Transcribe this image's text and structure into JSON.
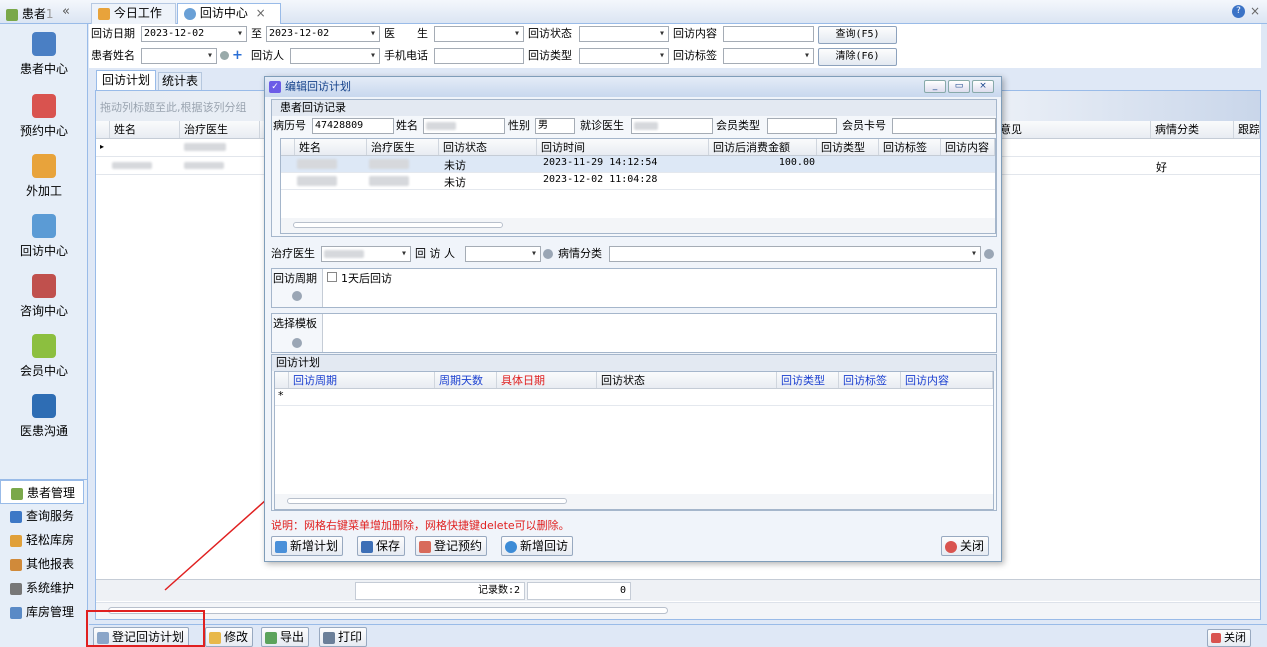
{
  "top_tabs": {
    "patient_panel_title": "患者",
    "collapse_glyph": "«",
    "tab1_label": "今日工作",
    "tab2_label": "回访中心",
    "close_glyph": "×",
    "help_glyph": "?"
  },
  "left_nav": {
    "big_items": [
      {
        "label": "患者中心",
        "icon": "patients-icon",
        "color": "#4a7fc4"
      },
      {
        "label": "预约中心",
        "icon": "calendar-icon",
        "color": "#d9534f"
      },
      {
        "label": "外加工",
        "icon": "cubes-icon",
        "color": "#e8a33b"
      },
      {
        "label": "回访中心",
        "icon": "refresh-icon",
        "color": "#5b9bd5"
      },
      {
        "label": "咨询中心",
        "icon": "consult-icon",
        "color": "#c0504d"
      },
      {
        "label": "会员中心",
        "icon": "members-icon",
        "color": "#8cbf3f"
      },
      {
        "label": "医患沟通",
        "icon": "media-icon",
        "color": "#2e6db4"
      }
    ],
    "small_items": [
      {
        "label": "患者管理",
        "icon": "patients-small-icon",
        "color": "#7aa84a"
      },
      {
        "label": "查询服务",
        "icon": "search-small-icon",
        "color": "#3d78c6"
      },
      {
        "label": "轻松库房",
        "icon": "box-small-icon",
        "color": "#e0a03a"
      },
      {
        "label": "其他报表",
        "icon": "report-small-icon",
        "color": "#d08a3a"
      },
      {
        "label": "系统维护",
        "icon": "gears-small-icon",
        "color": "#777777"
      },
      {
        "label": "库房管理",
        "icon": "warehouse-small-icon",
        "color": "#5a8ac6"
      }
    ]
  },
  "filter": {
    "date_label": "回访日期",
    "date_from": "2023-12-02",
    "to_label": "至",
    "date_to": "2023-12-02",
    "doctor_label": "医　　生",
    "status_label": "回访状态",
    "content_label": "回访内容",
    "query_button": "查询(F5)",
    "patient_name_label": "患者姓名",
    "visitor_label": "回访人",
    "phone_label": "手机电话",
    "type_label": "回访类型",
    "tag_label": "回访标签",
    "clear_button": "清除(F6)"
  },
  "subtabs": {
    "plan": "回访计划",
    "stats": "统计表"
  },
  "main_grid": {
    "group_hint": "拖动列标题至此,根据该列分组",
    "col_name": "姓名",
    "col_doctor": "治疗医生",
    "col_opinion": "意见",
    "col_category": "病情分类",
    "col_follow": "跟踪",
    "row2_category": "好",
    "record_label": "记录数:2",
    "record_count": "0"
  },
  "bottom_toolbar": {
    "register_plan": "登记回访计划",
    "modify": "修改",
    "export": "导出",
    "print": "打印",
    "close": "关闭"
  },
  "dialog": {
    "title": "编辑回访计划",
    "record_section": "患者回访记录",
    "mrn_label": "病历号",
    "mrn_value": "47428809",
    "name_label": "姓名",
    "gender_label": "性别",
    "gender_value": "男",
    "doctor_label": "就诊医生",
    "member_type_label": "会员类型",
    "member_card_label": "会员卡号",
    "record_cols": [
      "姓名",
      "治疗医生",
      "回访状态",
      "回访时间",
      "回访后消费金额",
      "回访类型",
      "回访标签",
      "回访内容"
    ],
    "records": [
      {
        "status": "未访",
        "time": "2023-11-29 14:12:54",
        "amount": "100.00"
      },
      {
        "status": "未访",
        "time": "2023-12-02 11:04:28",
        "amount": ""
      }
    ],
    "treat_doctor_label": "治疗医生",
    "visitor_label": "回 访 人",
    "category_label": "病情分类",
    "period_label": "回访周期",
    "period_option": "1天后回访",
    "template_label": "选择模板",
    "plan_section": "回访计划",
    "plan_cols": [
      "回访周期",
      "周期天数",
      "具体日期",
      "回访状态",
      "回访类型",
      "回访标签",
      "回访内容"
    ],
    "new_row_glyph": "*",
    "note": "说明：网格右键菜单增加删除，网格快捷键delete可以删除。",
    "btn_new_plan": "新增计划",
    "btn_save": "保存",
    "btn_register": "登记预约",
    "btn_new_visit": "新增回访",
    "btn_close": "关闭"
  },
  "colors": {
    "accent": "#15428b",
    "panel": "#dfe8f6",
    "note_red": "#e02020",
    "header_blue": "#1a3fd0"
  }
}
